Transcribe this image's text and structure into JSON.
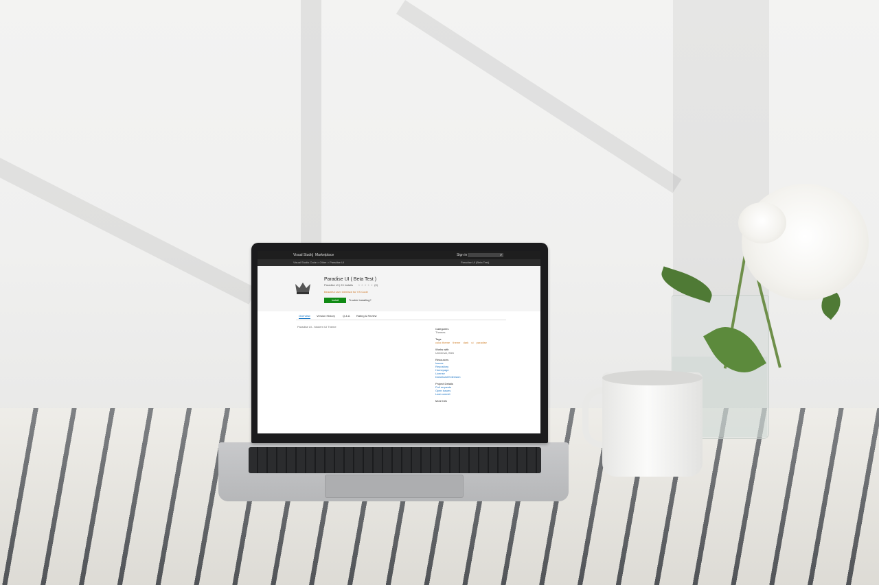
{
  "scene": {
    "colors": {
      "wall": "#f1f1f0",
      "tablecloth": "#e9e7e1",
      "stripes": "#55585c",
      "laptop_body": "#c2c3c5",
      "accent_green": "#108a14",
      "link_blue": "#1a73c4"
    },
    "objects": [
      "laptop",
      "white-mug",
      "glass-vase",
      "white-peony"
    ]
  },
  "screen": {
    "topbar": {
      "brand": "Visual Studio",
      "section": "Marketplace",
      "signin": "Sign in"
    },
    "breadcrumb": "Visual Studio Code > Other > Paradise UI",
    "publisher_note": "Paradise UI (Beta Test)",
    "extension": {
      "title": "Paradise UI ( Beta Test )",
      "publisher": "Paradise UI",
      "installs": "| 23 installs",
      "rating": "(0)",
      "description": "Beautiful user interface for VS Code",
      "install_label": "Install",
      "install_note": "Trouble Installing?"
    },
    "tabs": [
      {
        "label": "Overview",
        "active": true
      },
      {
        "label": "Version History",
        "active": false
      },
      {
        "label": "Q & A",
        "active": false
      },
      {
        "label": "Rating & Review",
        "active": false
      }
    ],
    "overview_text": "Paradise UI - Modern UI Theme",
    "sidebar": {
      "categories_heading": "Categories",
      "categories_value": "Themes",
      "tags_heading": "Tags",
      "tags": [
        "color-theme",
        "theme",
        "dark",
        "ui",
        "paradise"
      ],
      "works_with_heading": "Works with",
      "works_with_value": "Universal, Web",
      "resources_heading": "Resources",
      "resources": [
        "Issues",
        "Repository",
        "Homepage",
        "License",
        "Download Extension"
      ],
      "project_details_heading": "Project Details",
      "project_details": [
        "Pull requests",
        "Open issues",
        "Last commit"
      ],
      "more_info_heading": "More Info"
    }
  }
}
